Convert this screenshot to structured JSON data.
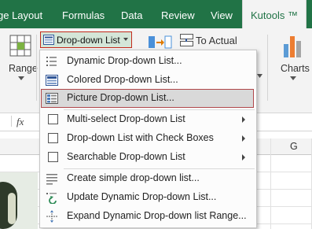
{
  "ribbon": {
    "tabs": [
      "ge Layout",
      "Formulas",
      "Data",
      "Review",
      "View",
      "Kutools ™"
    ],
    "active_tab": "Kutools ™",
    "range_label": "Range",
    "dropdown_button_label": "Drop-down List",
    "to_actual_label": "To Actual",
    "charts_label": "Charts"
  },
  "formula_bar": {
    "fx_label": "fx"
  },
  "grid": {
    "column_g": "G"
  },
  "menu": {
    "items": [
      {
        "label": "Dynamic Drop-down List...",
        "icon": "dynamic-list-icon"
      },
      {
        "label": "Colored Drop-down List...",
        "icon": "colored-list-icon"
      },
      {
        "label": "Picture Drop-down List...",
        "icon": "picture-list-icon",
        "highlighted": true
      },
      {
        "label": "Multi-select Drop-down List",
        "icon": "checkbox-icon",
        "submenu": true
      },
      {
        "label": "Drop-down List with Check Boxes",
        "icon": "checkbox-icon",
        "submenu": true
      },
      {
        "label": "Searchable Drop-down List",
        "icon": "checkbox-icon",
        "submenu": true
      },
      {
        "label": "Create simple drop-down list...",
        "icon": "simple-list-icon"
      },
      {
        "label": "Update Dynamic Drop-down List...",
        "icon": "update-list-icon"
      },
      {
        "label": "Expand Dynamic Drop-down list Range...",
        "icon": "expand-range-icon"
      }
    ]
  },
  "colors": {
    "ribbon_green": "#217346",
    "highlight_border": "#b0474a",
    "button_border": "#c42b1c"
  }
}
